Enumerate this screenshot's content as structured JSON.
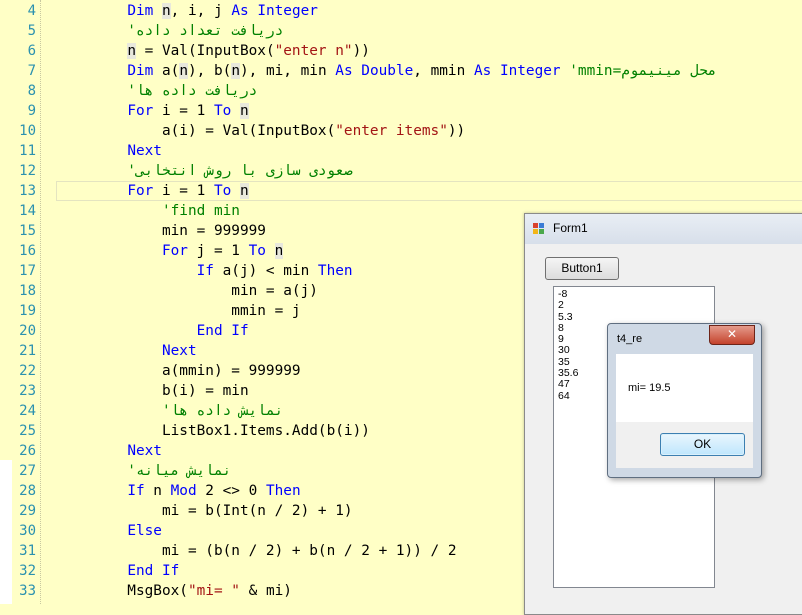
{
  "editor": {
    "lines": [
      {
        "num": "4",
        "segs": [
          {
            "t": "        ",
            "c": ""
          },
          {
            "t": "Dim",
            "c": "kw"
          },
          {
            "t": " ",
            "c": ""
          },
          {
            "t": "n",
            "c": "hl"
          },
          {
            "t": ", i, j ",
            "c": ""
          },
          {
            "t": "As",
            "c": "kw"
          },
          {
            "t": " ",
            "c": ""
          },
          {
            "t": "Integer",
            "c": "kw"
          }
        ]
      },
      {
        "num": "5",
        "segs": [
          {
            "t": "        'دریافت تعداد داده",
            "c": "cm"
          }
        ]
      },
      {
        "num": "6",
        "segs": [
          {
            "t": "        ",
            "c": ""
          },
          {
            "t": "n",
            "c": "hl"
          },
          {
            "t": " = Val(InputBox(",
            "c": ""
          },
          {
            "t": "\"enter n\"",
            "c": "str"
          },
          {
            "t": "))",
            "c": ""
          }
        ]
      },
      {
        "num": "7",
        "segs": [
          {
            "t": "        ",
            "c": ""
          },
          {
            "t": "Dim",
            "c": "kw"
          },
          {
            "t": " a(",
            "c": ""
          },
          {
            "t": "n",
            "c": "hl"
          },
          {
            "t": "), b(",
            "c": ""
          },
          {
            "t": "n",
            "c": "hl"
          },
          {
            "t": "), mi, min ",
            "c": ""
          },
          {
            "t": "As",
            "c": "kw"
          },
          {
            "t": " ",
            "c": ""
          },
          {
            "t": "Double",
            "c": "kw"
          },
          {
            "t": ", mmin ",
            "c": ""
          },
          {
            "t": "As",
            "c": "kw"
          },
          {
            "t": " ",
            "c": ""
          },
          {
            "t": "Integer",
            "c": "kw"
          },
          {
            "t": " 'mmin=محل مینیموم",
            "c": "cm"
          }
        ]
      },
      {
        "num": "8",
        "segs": [
          {
            "t": "        'دریافت داده ها",
            "c": "cm"
          }
        ]
      },
      {
        "num": "9",
        "segs": [
          {
            "t": "        ",
            "c": ""
          },
          {
            "t": "For",
            "c": "kw"
          },
          {
            "t": " i = 1 ",
            "c": ""
          },
          {
            "t": "To",
            "c": "kw"
          },
          {
            "t": " ",
            "c": ""
          },
          {
            "t": "n",
            "c": "hl"
          }
        ]
      },
      {
        "num": "10",
        "segs": [
          {
            "t": "            a(i) = Val(InputBox(",
            "c": ""
          },
          {
            "t": "\"enter items\"",
            "c": "str"
          },
          {
            "t": "))",
            "c": ""
          }
        ]
      },
      {
        "num": "11",
        "segs": [
          {
            "t": "        ",
            "c": ""
          },
          {
            "t": "Next",
            "c": "kw"
          }
        ]
      },
      {
        "num": "12",
        "segs": [
          {
            "t": "        'صعودی سازی با روش انتخابی",
            "c": "cm"
          }
        ]
      },
      {
        "num": "13",
        "segs": [
          {
            "t": "        ",
            "c": ""
          },
          {
            "t": "For",
            "c": "kw"
          },
          {
            "t": " i = 1 ",
            "c": ""
          },
          {
            "t": "To",
            "c": "kw"
          },
          {
            "t": " ",
            "c": ""
          },
          {
            "t": "n",
            "c": "hl"
          }
        ]
      },
      {
        "num": "14",
        "segs": [
          {
            "t": "            'find min",
            "c": "cm"
          }
        ]
      },
      {
        "num": "15",
        "segs": [
          {
            "t": "            min = 999999",
            "c": ""
          }
        ]
      },
      {
        "num": "16",
        "segs": [
          {
            "t": "            ",
            "c": ""
          },
          {
            "t": "For",
            "c": "kw"
          },
          {
            "t": " j = 1 ",
            "c": ""
          },
          {
            "t": "To",
            "c": "kw"
          },
          {
            "t": " ",
            "c": ""
          },
          {
            "t": "n",
            "c": "hl"
          }
        ]
      },
      {
        "num": "17",
        "segs": [
          {
            "t": "                ",
            "c": ""
          },
          {
            "t": "If",
            "c": "kw"
          },
          {
            "t": " a(j) < min ",
            "c": ""
          },
          {
            "t": "Then",
            "c": "kw"
          }
        ]
      },
      {
        "num": "18",
        "segs": [
          {
            "t": "                    min = a(j)",
            "c": ""
          }
        ]
      },
      {
        "num": "19",
        "segs": [
          {
            "t": "                    mmin = j",
            "c": ""
          }
        ]
      },
      {
        "num": "20",
        "segs": [
          {
            "t": "                ",
            "c": ""
          },
          {
            "t": "End If",
            "c": "kw"
          }
        ]
      },
      {
        "num": "21",
        "segs": [
          {
            "t": "            ",
            "c": ""
          },
          {
            "t": "Next",
            "c": "kw"
          }
        ]
      },
      {
        "num": "22",
        "segs": [
          {
            "t": "            a(mmin) = 999999",
            "c": ""
          }
        ]
      },
      {
        "num": "23",
        "segs": [
          {
            "t": "            b(i) = min",
            "c": ""
          }
        ]
      },
      {
        "num": "24",
        "segs": [
          {
            "t": "            'نمایش داده ها",
            "c": "cm"
          }
        ]
      },
      {
        "num": "25",
        "segs": [
          {
            "t": "            ListBox1.Items.Add(b(i))",
            "c": ""
          }
        ]
      },
      {
        "num": "26",
        "segs": [
          {
            "t": "        ",
            "c": ""
          },
          {
            "t": "Next",
            "c": "kw"
          }
        ]
      },
      {
        "num": "27",
        "segs": [
          {
            "t": "        'نمایش میانه",
            "c": "cm"
          }
        ]
      },
      {
        "num": "28",
        "segs": [
          {
            "t": "        ",
            "c": ""
          },
          {
            "t": "If",
            "c": "kw"
          },
          {
            "t": " n ",
            "c": ""
          },
          {
            "t": "Mod",
            "c": "kw"
          },
          {
            "t": " 2 <> 0 ",
            "c": ""
          },
          {
            "t": "Then",
            "c": "kw"
          }
        ]
      },
      {
        "num": "29",
        "segs": [
          {
            "t": "            mi = b(Int(n / 2) + 1)",
            "c": ""
          }
        ]
      },
      {
        "num": "30",
        "segs": [
          {
            "t": "        ",
            "c": ""
          },
          {
            "t": "Else",
            "c": "kw"
          }
        ]
      },
      {
        "num": "31",
        "segs": [
          {
            "t": "            mi = (b(n / 2) + b(n / 2 + 1)) / 2",
            "c": ""
          }
        ]
      },
      {
        "num": "32",
        "segs": [
          {
            "t": "        ",
            "c": ""
          },
          {
            "t": "End If",
            "c": "kw"
          }
        ]
      },
      {
        "num": "33",
        "segs": [
          {
            "t": "        MsgBox(",
            "c": ""
          },
          {
            "t": "\"mi= \"",
            "c": "str"
          },
          {
            "t": " & mi)",
            "c": ""
          }
        ]
      }
    ]
  },
  "form1": {
    "title": "Form1",
    "button1_label": "Button1",
    "list_items": [
      "-8",
      "2",
      "5.3",
      "8",
      "9",
      "30",
      "35",
      "35.6",
      "47",
      "64"
    ]
  },
  "msgbox": {
    "title": "t4_re",
    "close_glyph": "✕",
    "text": "mi= 19.5",
    "ok_label": "OK"
  }
}
